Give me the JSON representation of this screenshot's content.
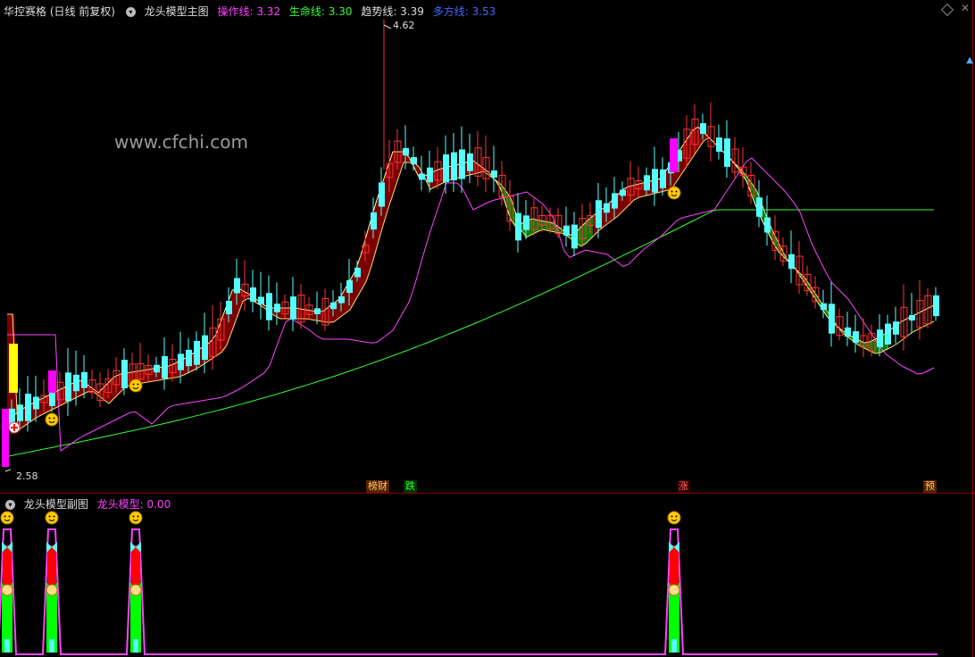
{
  "main": {
    "title": "华控赛格 (日线 前复权)",
    "indicator_name": "龙头模型主图",
    "lines": [
      {
        "label": "操作线: 3.32",
        "color": "#ff44ff"
      },
      {
        "label": "生命线: 3.30",
        "color": "#33ff33"
      },
      {
        "label": "趋势线: 3.39",
        "color": "#dddddd"
      },
      {
        "label": "多方线: 3.53",
        "color": "#4466ff"
      }
    ],
    "watermark": "www.cfchi.com",
    "high_label": "4.62",
    "low_label": "2.58",
    "tags": [
      {
        "text": "榜财",
        "color": "#ffcc66",
        "bg": "#552200"
      },
      {
        "text": "跌",
        "color": "#33ff33",
        "bg": "#003300"
      },
      {
        "text": "涨",
        "color": "#ff6666",
        "bg": "#330000"
      },
      {
        "text": "预",
        "color": "#ffcc66",
        "bg": "#552200"
      }
    ]
  },
  "sub": {
    "indicator_name": "龙头模型副图",
    "value_label": "龙头模型: 0.00"
  },
  "icons": {
    "settings": "circle-dropdown-icon",
    "close": "close-icon",
    "restore": "diamond-icon",
    "smiley": "smiley-icon",
    "butterfly": "butterfly-icon",
    "money_bag": "money-bag-icon"
  },
  "chart_data": {
    "type": "candlestick",
    "high": 4.62,
    "low": 2.58,
    "close_last": 3.53,
    "colors": {
      "up": "#ff3333",
      "down": "#55ffff",
      "ma_short": "#ff44ff",
      "ma_long": "#33ff33",
      "trend": "#dddddd"
    }
  }
}
